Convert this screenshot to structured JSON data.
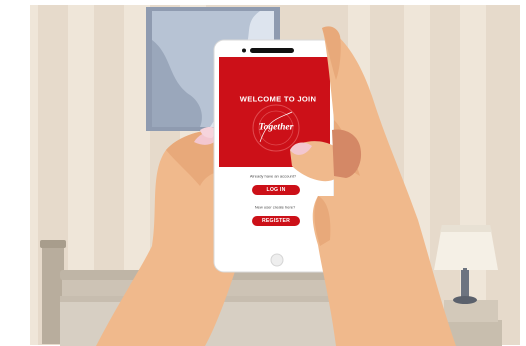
{
  "app": {
    "welcome_heading": "WELCOME TO JOIN",
    "logo_text": "Together",
    "login_prompt": "Already have an account?",
    "login_label": "LOG IN",
    "register_prompt": "New user create here?",
    "register_label": "REGISTER"
  },
  "colors": {
    "brand_red": "#cc1018",
    "skin": "#f0b98c",
    "wall": "#e6dacb"
  }
}
